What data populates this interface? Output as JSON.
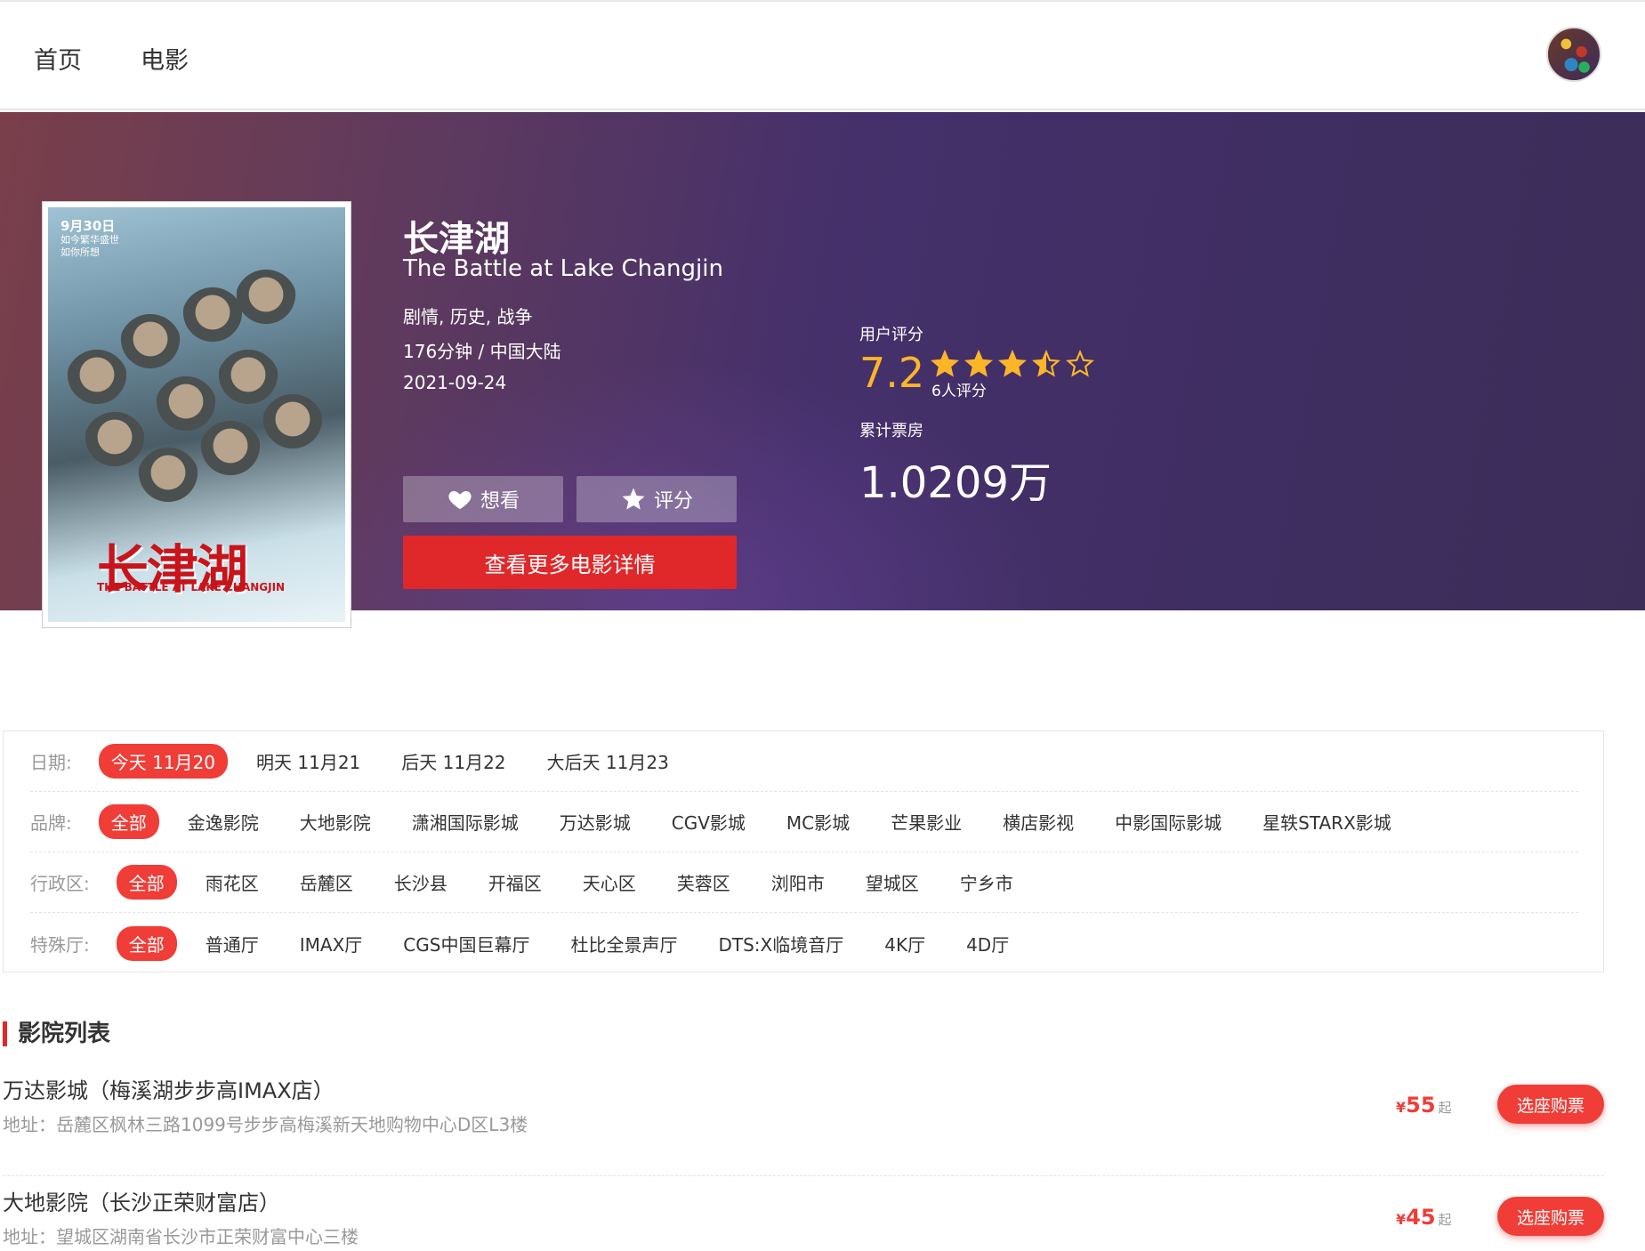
{
  "nav": {
    "home": "首页",
    "movies": "电影"
  },
  "movie": {
    "title": "长津湖",
    "title_en": "The Battle at Lake Changjin",
    "genres": "剧情, 历史, 战争",
    "duration_region": "176分钟 / 中国大陆",
    "release_date": "2021-09-24",
    "poster": {
      "date_text": "9月30日",
      "tagline": "如今繁华盛世 如你所想",
      "title_text": "长津湖",
      "subtitle_text": "THE BATTLE AT LAKE CHANGJIN"
    },
    "want_label": "想看",
    "rate_label": "评分",
    "details_label": "查看更多电影详情",
    "rating_label": "用户评分",
    "rating_value": "7.2",
    "rating_stars": 3.5,
    "rating_count": "6人评分",
    "boxoffice_label": "累计票房",
    "boxoffice_value": "1.0209万"
  },
  "filters": {
    "date": {
      "label": "日期:",
      "items": [
        "今天 11月20",
        "明天 11月21",
        "后天 11月22",
        "大后天 11月23"
      ],
      "active": 0
    },
    "brand": {
      "label": "品牌:",
      "items": [
        "全部",
        "金逸影院",
        "大地影院",
        "潇湘国际影城",
        "万达影城",
        "CGV影城",
        "MC影城",
        "芒果影业",
        "横店影视",
        "中影国际影城",
        "星轶STARX影城"
      ],
      "active": 0
    },
    "district": {
      "label": "行政区:",
      "items": [
        "全部",
        "雨花区",
        "岳麓区",
        "长沙县",
        "开福区",
        "天心区",
        "芙蓉区",
        "浏阳市",
        "望城区",
        "宁乡市"
      ],
      "active": 0
    },
    "hall": {
      "label": "特殊厅:",
      "items": [
        "全部",
        "普通厅",
        "IMAX厅",
        "CGS中国巨幕厅",
        "杜比全景声厅",
        "DTS:X临境音厅",
        "4K厅",
        "4D厅"
      ],
      "active": 0
    }
  },
  "cinema_list": {
    "title": "影院列表",
    "buy_label": "选座购票",
    "price_prefix": "¥",
    "price_suffix": "起",
    "items": [
      {
        "name": "万达影城（梅溪湖步步高IMAX店）",
        "address": "地址：岳麓区枫林三路1099号步步高梅溪新天地购物中心D区L3楼",
        "price": "55"
      },
      {
        "name": "大地影院（长沙正荣财富店）",
        "address": "地址：望城区湖南省长沙市正荣财富中心三楼",
        "price": "45"
      }
    ]
  },
  "colors": {
    "accent": "#e0282b",
    "tag_red": "#f03d37",
    "star": "#fdb528"
  }
}
